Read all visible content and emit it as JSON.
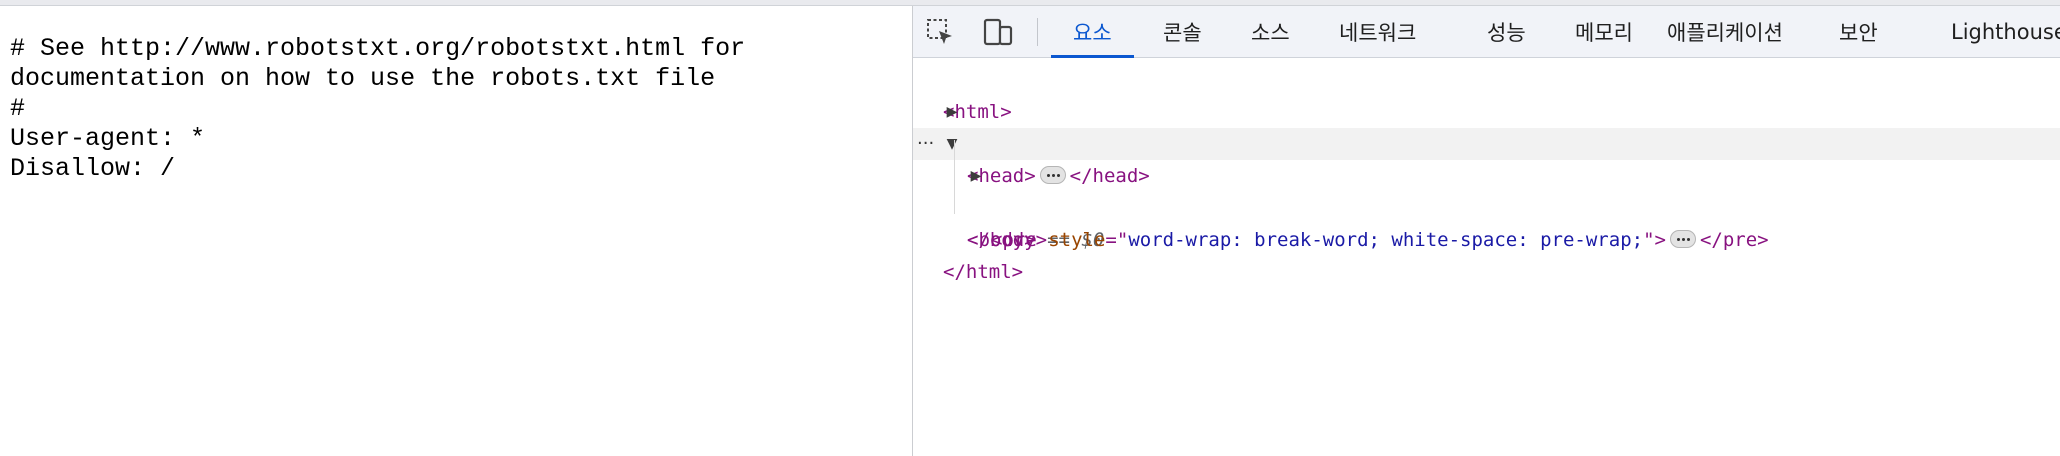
{
  "page": {
    "lines": [
      "# See http://www.robotstxt.org/robotstxt.html for",
      "documentation on how to use the robots.txt file",
      "#",
      "User-agent: *",
      "Disallow: /"
    ]
  },
  "devtools": {
    "toolbar": {
      "inspect_icon": "select-element-icon",
      "device_icon": "device-toolbar-icon",
      "tabs": [
        {
          "label": "요소",
          "active": true
        },
        {
          "label": "콘솔",
          "active": false
        },
        {
          "label": "소스",
          "active": false
        },
        {
          "label": "네트워크",
          "active": false
        },
        {
          "label": "성능",
          "active": false
        },
        {
          "label": "메모리",
          "active": false
        },
        {
          "label": "애플리케이션",
          "active": false
        },
        {
          "label": "보안",
          "active": false
        },
        {
          "label": "Lighthouse",
          "active": false
        }
      ]
    },
    "dom": {
      "html_open": "<html>",
      "head_open": "<head>",
      "head_close": "</head>",
      "body_open": "<body>",
      "selected_marker": "== $0",
      "row_menu": "···",
      "pre_open": "<pre",
      "pre_attr_name": "style",
      "pre_attr_eq": "=\"",
      "pre_attr_value": "word-wrap: break-word; white-space: pre-wrap;",
      "pre_attr_close": "\">",
      "pre_close": "</pre>",
      "body_close": "</body>",
      "html_close": "</html>"
    },
    "colors": {
      "accent": "#0b57d0",
      "tag": "#881280",
      "attr_name": "#994500",
      "attr_value": "#1a1aa6"
    }
  }
}
